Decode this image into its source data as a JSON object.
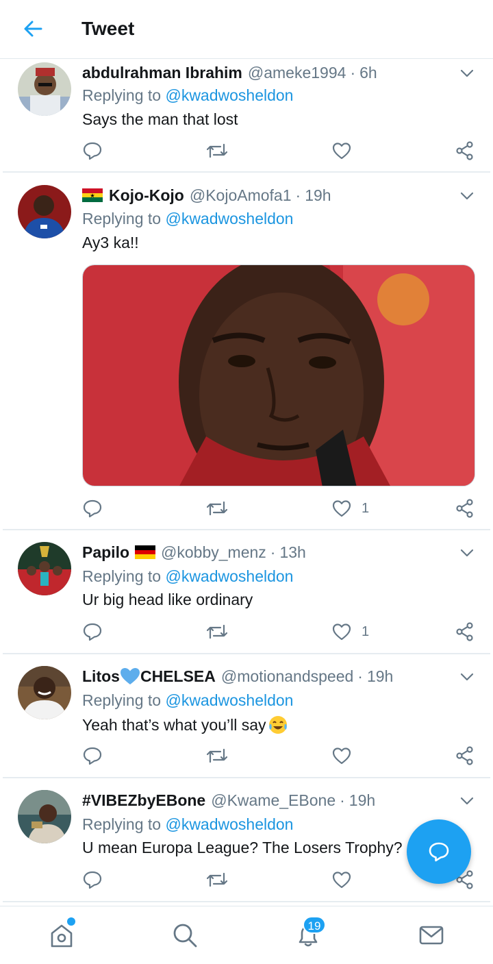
{
  "header": {
    "title": "Tweet"
  },
  "tweets": [
    {
      "name": "abdulrahman Ibrahim",
      "handle": "@ameke1994",
      "separator": "·",
      "time": "6h",
      "replying_prefix": "Replying to",
      "replying_to": "@kwadwosheldon",
      "text": "Says the man that lost",
      "like_count": ""
    },
    {
      "name": "Kojo-Kojo",
      "handle": "@KojoAmofa1",
      "separator": "·",
      "time": "19h",
      "replying_prefix": "Replying to",
      "replying_to": "@kwadwosheldon",
      "text": "Ay3 ka!!",
      "like_count": "1"
    },
    {
      "name": "Papilo",
      "handle": "@kobby_menz",
      "separator": "·",
      "time": "13h",
      "replying_prefix": "Replying to",
      "replying_to": "@kwadwosheldon",
      "text": "Ur big head like ordinary",
      "like_count": "1"
    },
    {
      "name_pre": "Litos",
      "name_post": "CHELSEA",
      "handle": "@motionandspeed",
      "separator": "·",
      "time": "19h",
      "replying_prefix": "Replying to",
      "replying_to": "@kwadwosheldon",
      "text": "Yeah that’s what you’ll say",
      "like_count": ""
    },
    {
      "name": "#VIBEZbyEBone",
      "handle": "@Kwame_EBone",
      "separator": "·",
      "time": "19h",
      "replying_prefix": "Replying to",
      "replying_to": "@kwadwosheldon",
      "text": "U mean Europa League? The Losers Trophy?",
      "like_count": ""
    }
  ],
  "nav": {
    "notifications_badge": "19"
  },
  "colors": {
    "accent": "#1da1f2",
    "mention": "#1b95e0",
    "muted": "#657786",
    "text": "#14171a"
  },
  "icons": [
    "back-arrow-icon",
    "chevron-down-icon",
    "reply-icon",
    "retweet-icon",
    "like-icon",
    "share-icon",
    "compose-icon",
    "home-icon",
    "search-icon",
    "notifications-icon",
    "messages-icon"
  ]
}
